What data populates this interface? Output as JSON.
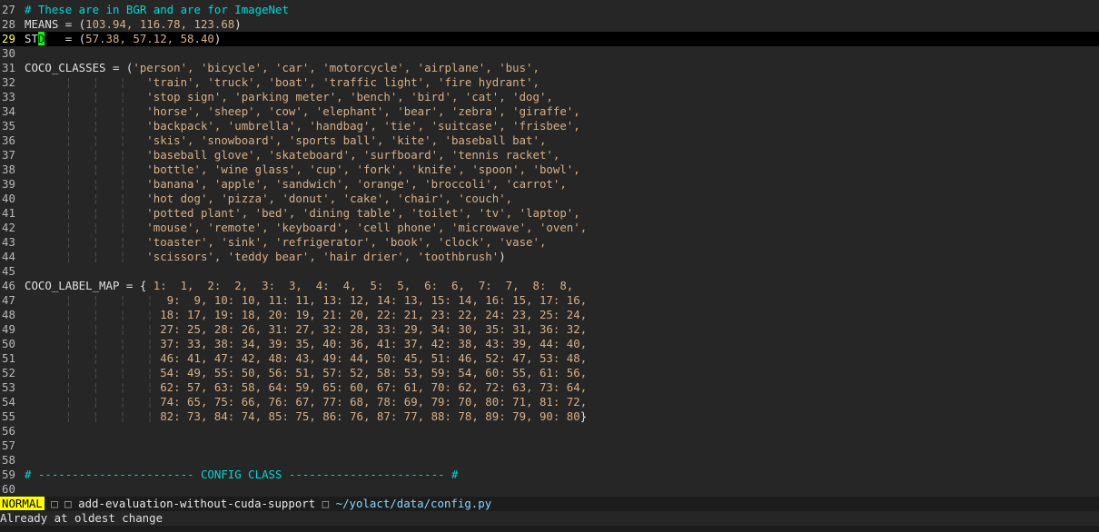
{
  "editor": {
    "lines": [
      {
        "n": "27",
        "segments": [
          {
            "t": "# These are in BGR and are for ImageNet",
            "c": "comment"
          }
        ]
      },
      {
        "n": "28",
        "segments": [
          {
            "t": "MEANS = (",
            "c": "plain"
          },
          {
            "t": "103.94, 116.78, 123.68",
            "c": "num"
          },
          {
            "t": ")",
            "c": "plain"
          }
        ]
      },
      {
        "n": "29",
        "cursorline": true,
        "segments": [
          {
            "t": "ST",
            "c": "plain"
          },
          {
            "t": "D",
            "c": "cursor"
          },
          {
            "t": "   = (",
            "c": "plain"
          },
          {
            "t": "57.38, 57.12, 58.40",
            "c": "num"
          },
          {
            "t": ")",
            "c": "plain"
          }
        ]
      },
      {
        "n": "30",
        "segments": []
      },
      {
        "n": "31",
        "segments": [
          {
            "t": "COCO_CLASSES = (",
            "c": "plain"
          },
          {
            "t": "'person', 'bicycle', 'car', 'motorcycle', 'airplane', 'bus',",
            "c": "str"
          }
        ]
      },
      {
        "n": "32",
        "segments": [
          {
            "t": "      ¦   ¦   ¦   ",
            "c": "tab"
          },
          {
            "t": "'train', 'truck', 'boat', 'traffic light', 'fire hydrant',",
            "c": "str"
          }
        ]
      },
      {
        "n": "33",
        "segments": [
          {
            "t": "      ¦   ¦   ¦   ",
            "c": "tab"
          },
          {
            "t": "'stop sign', 'parking meter', 'bench', 'bird', 'cat', 'dog',",
            "c": "str"
          }
        ]
      },
      {
        "n": "34",
        "segments": [
          {
            "t": "      ¦   ¦   ¦   ",
            "c": "tab"
          },
          {
            "t": "'horse', 'sheep', 'cow', 'elephant', 'bear', 'zebra', 'giraffe',",
            "c": "str"
          }
        ]
      },
      {
        "n": "35",
        "segments": [
          {
            "t": "      ¦   ¦   ¦   ",
            "c": "tab"
          },
          {
            "t": "'backpack', 'umbrella', 'handbag', 'tie', 'suitcase', 'frisbee',",
            "c": "str"
          }
        ]
      },
      {
        "n": "36",
        "segments": [
          {
            "t": "      ¦   ¦   ¦   ",
            "c": "tab"
          },
          {
            "t": "'skis', 'snowboard', 'sports ball', 'kite', 'baseball bat',",
            "c": "str"
          }
        ]
      },
      {
        "n": "37",
        "segments": [
          {
            "t": "      ¦   ¦   ¦   ",
            "c": "tab"
          },
          {
            "t": "'baseball glove', 'skateboard', 'surfboard', 'tennis racket',",
            "c": "str"
          }
        ]
      },
      {
        "n": "38",
        "segments": [
          {
            "t": "      ¦   ¦   ¦   ",
            "c": "tab"
          },
          {
            "t": "'bottle', 'wine glass', 'cup', 'fork', 'knife', 'spoon', 'bowl',",
            "c": "str"
          }
        ]
      },
      {
        "n": "39",
        "segments": [
          {
            "t": "      ¦   ¦   ¦   ",
            "c": "tab"
          },
          {
            "t": "'banana', 'apple', 'sandwich', 'orange', 'broccoli', 'carrot',",
            "c": "str"
          }
        ]
      },
      {
        "n": "40",
        "segments": [
          {
            "t": "      ¦   ¦   ¦   ",
            "c": "tab"
          },
          {
            "t": "'hot dog', 'pizza', 'donut', 'cake', 'chair', 'couch',",
            "c": "str"
          }
        ]
      },
      {
        "n": "41",
        "segments": [
          {
            "t": "      ¦   ¦   ¦   ",
            "c": "tab"
          },
          {
            "t": "'potted plant', 'bed', 'dining table', 'toilet', 'tv', 'laptop',",
            "c": "str"
          }
        ]
      },
      {
        "n": "42",
        "segments": [
          {
            "t": "      ¦   ¦   ¦   ",
            "c": "tab"
          },
          {
            "t": "'mouse', 'remote', 'keyboard', 'cell phone', 'microwave', 'oven',",
            "c": "str"
          }
        ]
      },
      {
        "n": "43",
        "segments": [
          {
            "t": "      ¦   ¦   ¦   ",
            "c": "tab"
          },
          {
            "t": "'toaster', 'sink', 'refrigerator', 'book', 'clock', 'vase',",
            "c": "str"
          }
        ]
      },
      {
        "n": "44",
        "segments": [
          {
            "t": "      ¦   ¦   ¦   ",
            "c": "tab"
          },
          {
            "t": "'scissors', 'teddy bear', 'hair drier', 'toothbrush'",
            "c": "str"
          },
          {
            "t": ")",
            "c": "plain"
          }
        ]
      },
      {
        "n": "45",
        "segments": []
      },
      {
        "n": "46",
        "segments": [
          {
            "t": "COCO_LABEL_MAP = { ",
            "c": "plain"
          },
          {
            "t": "1:  1,  2:  2,  3:  3,  4:  4,  5:  5,  6:  6,  7:  7,  8:  8,",
            "c": "num"
          }
        ]
      },
      {
        "n": "47",
        "segments": [
          {
            "t": "      ¦   ¦   ¦   ¦  ",
            "c": "tab"
          },
          {
            "t": "9:  9, 10: 10, 11: 11, 13: 12, 14: 13, 15: 14, 16: 15, 17: 16,",
            "c": "num"
          }
        ]
      },
      {
        "n": "48",
        "segments": [
          {
            "t": "      ¦   ¦   ¦   ¦ ",
            "c": "tab"
          },
          {
            "t": "18: 17, 19: 18, 20: 19, 21: 20, 22: 21, 23: 22, 24: 23, 25: 24,",
            "c": "num"
          }
        ]
      },
      {
        "n": "49",
        "segments": [
          {
            "t": "      ¦   ¦   ¦   ¦ ",
            "c": "tab"
          },
          {
            "t": "27: 25, 28: 26, 31: 27, 32: 28, 33: 29, 34: 30, 35: 31, 36: 32,",
            "c": "num"
          }
        ]
      },
      {
        "n": "50",
        "segments": [
          {
            "t": "      ¦   ¦   ¦   ¦ ",
            "c": "tab"
          },
          {
            "t": "37: 33, 38: 34, 39: 35, 40: 36, 41: 37, 42: 38, 43: 39, 44: 40,",
            "c": "num"
          }
        ]
      },
      {
        "n": "51",
        "segments": [
          {
            "t": "      ¦   ¦   ¦   ¦ ",
            "c": "tab"
          },
          {
            "t": "46: 41, 47: 42, 48: 43, 49: 44, 50: 45, 51: 46, 52: 47, 53: 48,",
            "c": "num"
          }
        ]
      },
      {
        "n": "52",
        "segments": [
          {
            "t": "      ¦   ¦   ¦   ¦ ",
            "c": "tab"
          },
          {
            "t": "54: 49, 55: 50, 56: 51, 57: 52, 58: 53, 59: 54, 60: 55, 61: 56,",
            "c": "num"
          }
        ]
      },
      {
        "n": "53",
        "segments": [
          {
            "t": "      ¦   ¦   ¦   ¦ ",
            "c": "tab"
          },
          {
            "t": "62: 57, 63: 58, 64: 59, 65: 60, 67: 61, 70: 62, 72: 63, 73: 64,",
            "c": "num"
          }
        ]
      },
      {
        "n": "54",
        "segments": [
          {
            "t": "      ¦   ¦   ¦   ¦ ",
            "c": "tab"
          },
          {
            "t": "74: 65, 75: 66, 76: 67, 77: 68, 78: 69, 79: 70, 80: 71, 81: 72,",
            "c": "num"
          }
        ]
      },
      {
        "n": "55",
        "segments": [
          {
            "t": "      ¦   ¦   ¦   ¦ ",
            "c": "tab"
          },
          {
            "t": "82: 73, 84: 74, 85: 75, 86: 76, 87: 77, 88: 78, 89: 79, 90: 80",
            "c": "num"
          },
          {
            "t": "}",
            "c": "plain"
          }
        ]
      },
      {
        "n": "56",
        "segments": []
      },
      {
        "n": "57",
        "segments": []
      },
      {
        "n": "58",
        "segments": []
      },
      {
        "n": "59",
        "segments": [
          {
            "t": "# ----------------------- CONFIG CLASS ----------------------- #",
            "c": "comment"
          }
        ]
      },
      {
        "n": "60",
        "segments": []
      }
    ]
  },
  "statusline": {
    "mode": "NORMAL",
    "branch_icon": "□",
    "branch_glyph": "□",
    "branch": "add-evaluation-without-cuda-support",
    "file_icon": "□",
    "filepath": "~/yolact/data/config.py"
  },
  "cmdline": {
    "message": "Already at oldest change"
  },
  "colors": {
    "background": "#262626",
    "comment": "#00d7d7",
    "number_string": "#d7af87",
    "cursor": "#00ff00",
    "mode_bg": "#ffff00",
    "filepath": "#87d7ff"
  }
}
